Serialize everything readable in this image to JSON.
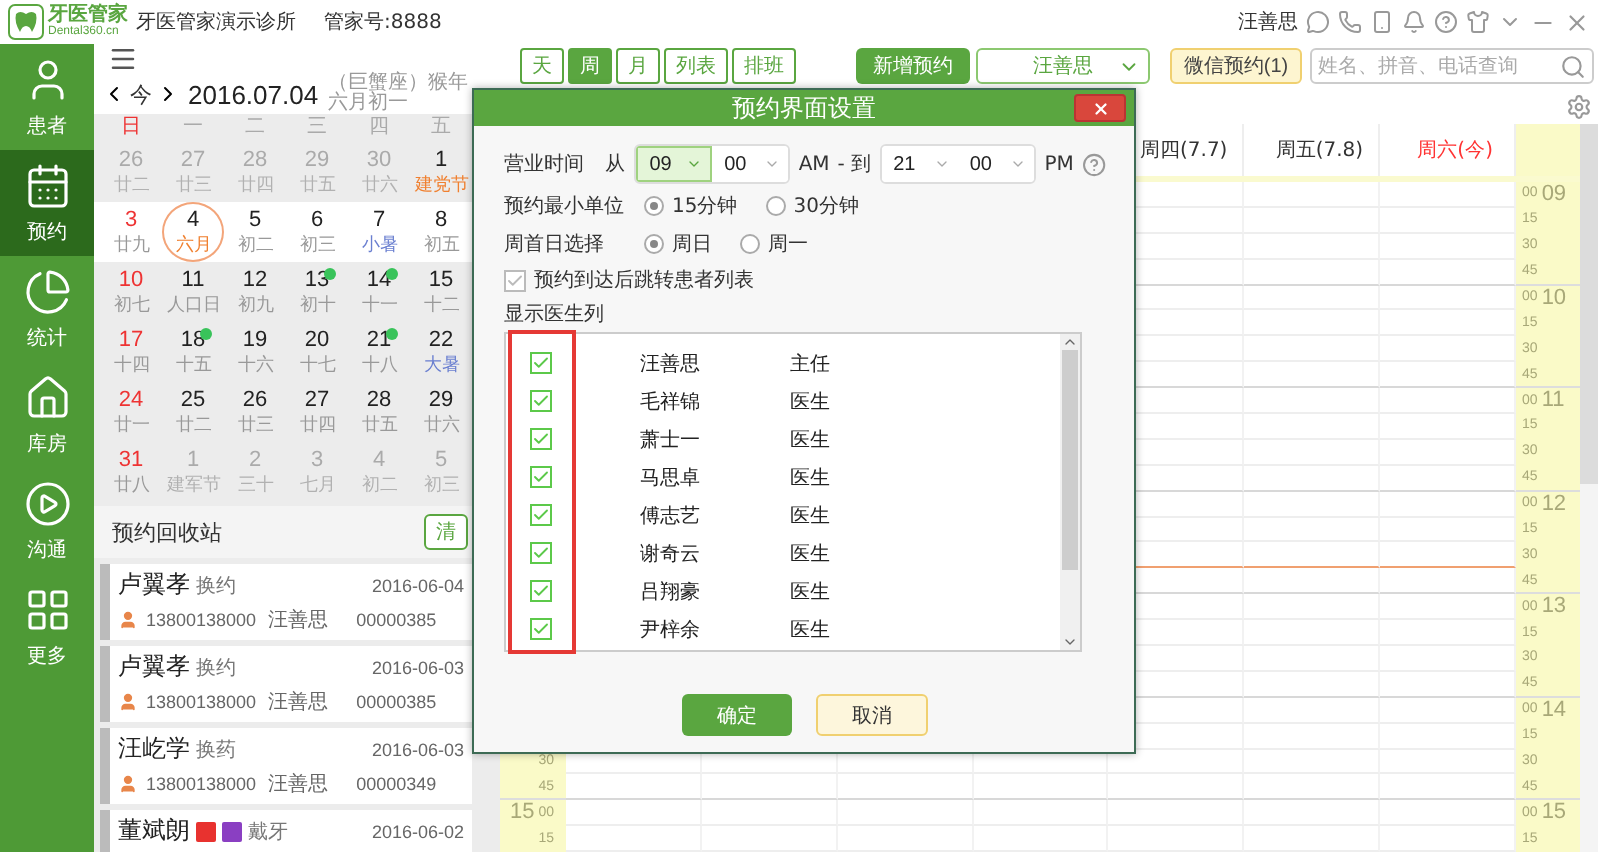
{
  "top_bar": {
    "logo_text": "牙医管家",
    "logo_domain": "Dental360.cn",
    "clinic": "牙医管家演示诊所",
    "account": "管家号:8888",
    "user": "汪善思"
  },
  "sidebar": {
    "items": [
      {
        "label": "患者",
        "selected": false
      },
      {
        "label": "预约",
        "selected": true
      },
      {
        "label": "统计",
        "selected": false
      },
      {
        "label": "库房",
        "selected": false
      },
      {
        "label": "沟通",
        "selected": false
      },
      {
        "label": "更多",
        "selected": false
      }
    ]
  },
  "calendar": {
    "today_button": "今",
    "date": "2016.07.04",
    "lunar_info": "（巨蟹座）猴年六月初一",
    "weekdays": [
      {
        "label": "日",
        "weekend": true
      },
      {
        "label": "一",
        "weekend": false
      },
      {
        "label": "二",
        "weekend": false
      },
      {
        "label": "三",
        "weekend": false
      },
      {
        "label": "四",
        "weekend": false
      },
      {
        "label": "五",
        "weekend": false
      }
    ],
    "weeks": [
      {
        "selected": false,
        "days": [
          {
            "d": "26",
            "lunar": "廿二",
            "other_month": true,
            "today": false,
            "dot": false,
            "kind": "normal"
          },
          {
            "d": "27",
            "lunar": "廿三",
            "other_month": true,
            "today": false,
            "dot": false,
            "kind": "normal"
          },
          {
            "d": "28",
            "lunar": "廿四",
            "other_month": true,
            "today": false,
            "dot": false,
            "kind": "normal"
          },
          {
            "d": "29",
            "lunar": "廿五",
            "other_month": true,
            "today": false,
            "dot": false,
            "kind": "normal"
          },
          {
            "d": "30",
            "lunar": "廿六",
            "other_month": true,
            "today": false,
            "dot": false,
            "kind": "normal"
          },
          {
            "d": "1",
            "lunar": "建党节",
            "other_month": false,
            "today": false,
            "dot": false,
            "kind": "festival"
          }
        ]
      },
      {
        "selected": true,
        "days": [
          {
            "d": "3",
            "lunar": "廿九",
            "other_month": false,
            "today": false,
            "dot": false,
            "kind": "normal"
          },
          {
            "d": "4",
            "lunar": "六月",
            "other_month": false,
            "today": true,
            "dot": false,
            "kind": "festival"
          },
          {
            "d": "5",
            "lunar": "初二",
            "other_month": false,
            "today": false,
            "dot": false,
            "kind": "normal"
          },
          {
            "d": "6",
            "lunar": "初三",
            "other_month": false,
            "today": false,
            "dot": false,
            "kind": "normal"
          },
          {
            "d": "7",
            "lunar": "小暑",
            "other_month": false,
            "today": false,
            "dot": false,
            "kind": "term"
          },
          {
            "d": "8",
            "lunar": "初五",
            "other_month": false,
            "today": false,
            "dot": false,
            "kind": "normal"
          }
        ]
      },
      {
        "selected": false,
        "days": [
          {
            "d": "10",
            "lunar": "初七",
            "other_month": false,
            "today": false,
            "dot": false,
            "kind": "normal"
          },
          {
            "d": "11",
            "lunar": "人口日",
            "other_month": false,
            "today": false,
            "dot": false,
            "kind": "normal"
          },
          {
            "d": "12",
            "lunar": "初九",
            "other_month": false,
            "today": false,
            "dot": false,
            "kind": "normal"
          },
          {
            "d": "13",
            "lunar": "初十",
            "other_month": false,
            "today": false,
            "dot": true,
            "kind": "normal"
          },
          {
            "d": "14",
            "lunar": "十一",
            "other_month": false,
            "today": false,
            "dot": true,
            "kind": "normal"
          },
          {
            "d": "15",
            "lunar": "十二",
            "other_month": false,
            "today": false,
            "dot": false,
            "kind": "normal"
          }
        ]
      },
      {
        "selected": false,
        "days": [
          {
            "d": "17",
            "lunar": "十四",
            "other_month": false,
            "today": false,
            "dot": false,
            "kind": "normal"
          },
          {
            "d": "18",
            "lunar": "十五",
            "other_month": false,
            "today": false,
            "dot": true,
            "kind": "normal"
          },
          {
            "d": "19",
            "lunar": "十六",
            "other_month": false,
            "today": false,
            "dot": false,
            "kind": "normal"
          },
          {
            "d": "20",
            "lunar": "十七",
            "other_month": false,
            "today": false,
            "dot": false,
            "kind": "normal"
          },
          {
            "d": "21",
            "lunar": "十八",
            "other_month": false,
            "today": false,
            "dot": true,
            "kind": "normal"
          },
          {
            "d": "22",
            "lunar": "大暑",
            "other_month": false,
            "today": false,
            "dot": false,
            "kind": "term"
          }
        ]
      },
      {
        "selected": false,
        "days": [
          {
            "d": "24",
            "lunar": "廿一",
            "other_month": false,
            "today": false,
            "dot": false,
            "kind": "normal"
          },
          {
            "d": "25",
            "lunar": "廿二",
            "other_month": false,
            "today": false,
            "dot": false,
            "kind": "normal"
          },
          {
            "d": "26",
            "lunar": "廿三",
            "other_month": false,
            "today": false,
            "dot": false,
            "kind": "normal"
          },
          {
            "d": "27",
            "lunar": "廿四",
            "other_month": false,
            "today": false,
            "dot": false,
            "kind": "normal"
          },
          {
            "d": "28",
            "lunar": "廿五",
            "other_month": false,
            "today": false,
            "dot": false,
            "kind": "normal"
          },
          {
            "d": "29",
            "lunar": "廿六",
            "other_month": false,
            "today": false,
            "dot": false,
            "kind": "normal"
          }
        ]
      },
      {
        "selected": false,
        "days": [
          {
            "d": "31",
            "lunar": "廿八",
            "other_month": false,
            "today": false,
            "dot": false,
            "kind": "normal"
          },
          {
            "d": "1",
            "lunar": "建军节",
            "other_month": true,
            "today": false,
            "dot": false,
            "kind": "normal"
          },
          {
            "d": "2",
            "lunar": "三十",
            "other_month": true,
            "today": false,
            "dot": false,
            "kind": "normal"
          },
          {
            "d": "3",
            "lunar": "七月",
            "other_month": true,
            "today": false,
            "dot": false,
            "kind": "normal"
          },
          {
            "d": "4",
            "lunar": "初二",
            "other_month": true,
            "today": false,
            "dot": false,
            "kind": "normal"
          },
          {
            "d": "5",
            "lunar": "初三",
            "other_month": true,
            "today": false,
            "dot": false,
            "kind": "normal"
          }
        ]
      }
    ]
  },
  "recycle_bin": {
    "title": "预约回收站",
    "clear_button": "清",
    "cards": [
      {
        "name": "卢翼孝",
        "tags": [
          {
            "kind": "text",
            "label": "换约"
          }
        ],
        "date": "2016-06-04",
        "phone": "13800138000",
        "doctor": "汪善思",
        "record_no": "00000385"
      },
      {
        "name": "卢翼孝",
        "tags": [
          {
            "kind": "text",
            "label": "换约"
          }
        ],
        "date": "2016-06-03",
        "phone": "13800138000",
        "doctor": "汪善思",
        "record_no": "00000385"
      },
      {
        "name": "汪屹学",
        "tags": [
          {
            "kind": "text",
            "label": "换药"
          }
        ],
        "date": "2016-06-03",
        "phone": "13800138000",
        "doctor": "汪善思",
        "record_no": "00000349"
      },
      {
        "name": "董斌朗",
        "tags": [
          {
            "kind": "badge",
            "color": "#e8322f"
          },
          {
            "kind": "badge",
            "color": "#8a3fc2"
          },
          {
            "kind": "text",
            "label": "戴牙"
          }
        ],
        "date": "2016-06-02"
      }
    ]
  },
  "toolbar": {
    "views": [
      {
        "label": "天",
        "selected": false
      },
      {
        "label": "周",
        "selected": true
      },
      {
        "label": "月",
        "selected": false
      },
      {
        "label": "列表",
        "selected": false
      },
      {
        "label": "排班",
        "selected": false
      }
    ],
    "new_button": "新增预约",
    "doctor_select": "汪善思",
    "wechat_button": "微信预约(1)",
    "search_placeholder": "姓名、拼音、电话查询"
  },
  "schedule": {
    "day_headers": [
      {
        "label": "周四(7.7)",
        "today": false
      },
      {
        "label": "周五(7.8)",
        "today": false
      },
      {
        "label": "周六(今)",
        "today": true
      }
    ],
    "time_slots": [
      {
        "hour": "09",
        "minute": "00",
        "now_line": false
      },
      {
        "minute": "15",
        "now_line": false
      },
      {
        "minute": "30",
        "now_line": false
      },
      {
        "minute": "45",
        "now_line": false
      },
      {
        "hour": "10",
        "minute": "00",
        "now_line": false
      },
      {
        "minute": "15",
        "now_line": false
      },
      {
        "minute": "30",
        "now_line": false
      },
      {
        "minute": "45",
        "now_line": false
      },
      {
        "hour": "11",
        "minute": "00",
        "now_line": false
      },
      {
        "minute": "15",
        "now_line": false
      },
      {
        "minute": "30",
        "now_line": false
      },
      {
        "minute": "45",
        "now_line": false
      },
      {
        "hour": "12",
        "minute": "00",
        "now_line": false
      },
      {
        "minute": "15",
        "now_line": false
      },
      {
        "minute": "30",
        "now_line": true
      },
      {
        "minute": "45",
        "now_line": false
      },
      {
        "hour": "13",
        "minute": "00",
        "now_line": false
      },
      {
        "minute": "15",
        "now_line": false
      },
      {
        "minute": "30",
        "now_line": false
      },
      {
        "minute": "45",
        "now_line": false
      },
      {
        "hour": "14",
        "minute": "00",
        "now_line": false
      },
      {
        "minute": "15",
        "now_line": false
      },
      {
        "minute": "30",
        "now_line": false,
        "left": {
          "minute": "30"
        }
      },
      {
        "minute": "45",
        "now_line": false,
        "left": {
          "minute": "45"
        }
      },
      {
        "hour": "15",
        "minute": "00",
        "now_line": false,
        "left": {
          "hour": "15",
          "minute": "00"
        }
      },
      {
        "minute": "15",
        "now_line": false,
        "left": {
          "minute": "15"
        }
      }
    ]
  },
  "dialog": {
    "title": "预约界面设置",
    "hours_label": "营业时间",
    "from_label": "从",
    "start_hour": {
      "value": "09",
      "focused": true
    },
    "start_minute": "00",
    "am_label": "AM",
    "to_label": "- 到",
    "end_hour": "21",
    "end_minute": "00",
    "pm_label": "PM",
    "unit_label": "预约最小单位",
    "unit_options": [
      {
        "label": "15分钟",
        "selected": true
      },
      {
        "label": "30分钟",
        "selected": false
      }
    ],
    "week_start_label": "周首日选择",
    "week_start_options": [
      {
        "label": "周日",
        "selected": true
      },
      {
        "label": "周一",
        "selected": false
      }
    ],
    "jump_option": {
      "label": "预约到达后跳转患者列表",
      "checked": true,
      "disabled": true
    },
    "doctors_label": "显示医生列",
    "doctors": [
      {
        "name": "汪善思",
        "title": "主任",
        "checked": true
      },
      {
        "name": "毛祥锦",
        "title": "医生",
        "checked": true
      },
      {
        "name": "萧士一",
        "title": "医生",
        "checked": true
      },
      {
        "name": "马思卓",
        "title": "医生",
        "checked": true
      },
      {
        "name": "傅志艺",
        "title": "医生",
        "checked": true
      },
      {
        "name": "谢奇云",
        "title": "医生",
        "checked": true
      },
      {
        "name": "吕翔豪",
        "title": "医生",
        "checked": true
      },
      {
        "name": "尹梓余",
        "title": "医生",
        "checked": true
      }
    ],
    "ok_button": "确定",
    "cancel_button": "取消"
  }
}
